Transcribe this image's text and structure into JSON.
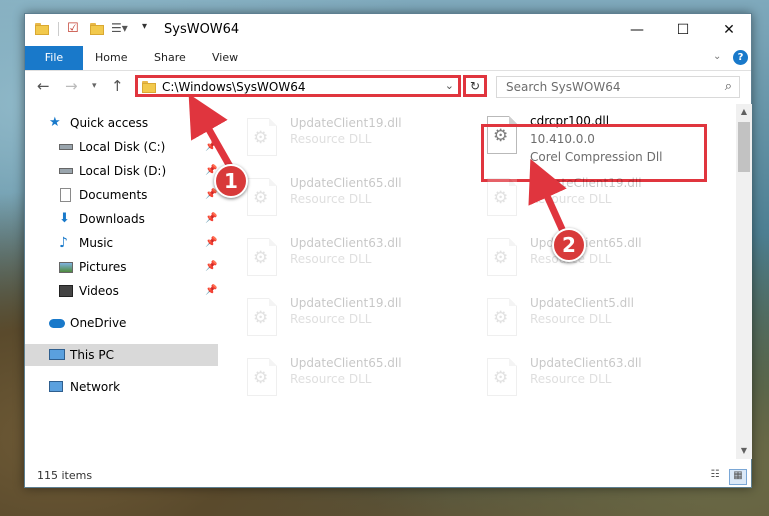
{
  "window": {
    "title": "SysWOW64"
  },
  "ribbon": {
    "tabs": [
      "File",
      "Home",
      "Share",
      "View"
    ]
  },
  "address": {
    "path": "C:\\Windows\\SysWOW64"
  },
  "search": {
    "placeholder": "Search SysWOW64"
  },
  "nav": {
    "items": [
      {
        "label": "Quick access",
        "icon": "star-icon"
      },
      {
        "label": "Local Disk (C:)",
        "icon": "drive-icon",
        "pinned": true
      },
      {
        "label": "Local Disk (D:)",
        "icon": "drive-icon",
        "pinned": true
      },
      {
        "label": "Documents",
        "icon": "documents-icon",
        "pinned": true
      },
      {
        "label": "Downloads",
        "icon": "download-icon",
        "pinned": true
      },
      {
        "label": "Music",
        "icon": "music-icon",
        "pinned": true
      },
      {
        "label": "Pictures",
        "icon": "pictures-icon",
        "pinned": true
      },
      {
        "label": "Videos",
        "icon": "videos-icon",
        "pinned": true
      },
      {
        "label": "OneDrive",
        "icon": "cloud-icon"
      },
      {
        "label": "This PC",
        "icon": "computer-icon",
        "selected": true
      },
      {
        "label": "Network",
        "icon": "network-icon"
      }
    ]
  },
  "files": {
    "highlighted": {
      "name": "cdrcpr100.dll",
      "version": "10.410.0.0",
      "description": "Corel Compression Dll"
    },
    "left": [
      {
        "name": "UpdateClient19.dll",
        "type": "Resource DLL"
      },
      {
        "name": "UpdateClient65.dll",
        "type": "Resource DLL"
      },
      {
        "name": "UpdateClient63.dll",
        "type": "Resource DLL"
      },
      {
        "name": "UpdateClient19.dll",
        "type": "Resource DLL"
      },
      {
        "name": "UpdateClient65.dll",
        "type": "Resource DLL"
      }
    ],
    "right": [
      {
        "name": "UpdateClient19.dll",
        "type": "Resource DLL"
      },
      {
        "name": "UpdateClient65.dll",
        "type": "Resource DLL"
      },
      {
        "name": "UpdateClient5.dll",
        "type": "Resource DLL"
      },
      {
        "name": "UpdateClient63.dll",
        "type": "Resource DLL"
      }
    ]
  },
  "status": {
    "item_count": "115 items"
  },
  "callouts": [
    "1",
    "2"
  ],
  "colors": {
    "accent": "#1979ca",
    "highlight": "#e0353e",
    "callout": "#d83a3a"
  }
}
